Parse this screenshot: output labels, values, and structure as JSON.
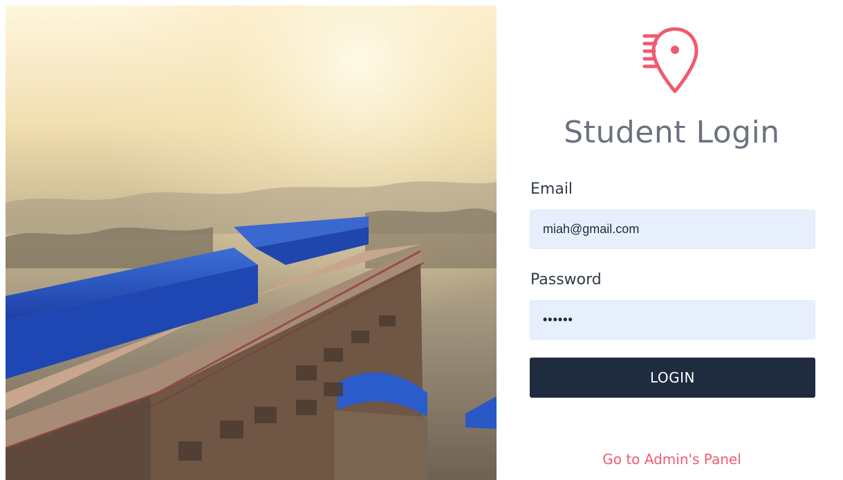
{
  "photo": {
    "icon": "campus-building-photo"
  },
  "login": {
    "logo_icon": "speed-location-pin-icon",
    "title": "Student Login",
    "email_label": "Email",
    "email_value": "miah@gmail.com",
    "password_label": "Password",
    "password_value": "••••••",
    "login_button": "LOGIN",
    "admin_link": "Go to Admin's Panel"
  },
  "colors": {
    "accent": "#f05a6f",
    "button": "#1f2b3e",
    "input_bg": "#e8effc",
    "title": "#6b7280"
  }
}
